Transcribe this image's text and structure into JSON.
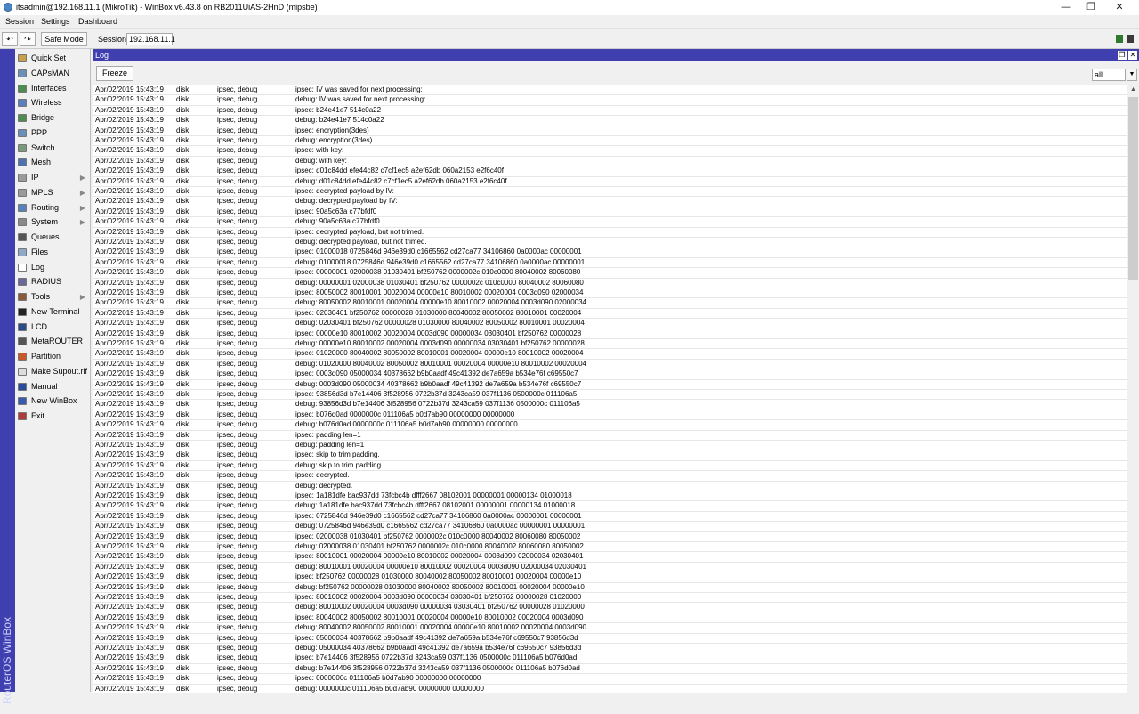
{
  "window": {
    "title": "itsadmin@192.168.11.1 (MikroTik) - WinBox v6.43.8 on RB2011UiAS-2HnD (mipsbe)",
    "minimize": "—",
    "maximize": "❐",
    "close": "✕"
  },
  "menu": {
    "session": "Session",
    "settings": "Settings",
    "dashboard": "Dashboard"
  },
  "toolbar": {
    "undo": "↶",
    "redo": "↷",
    "safe_mode": "Safe Mode",
    "session_label": "Session:",
    "session_value": "192.168.11.1",
    "status_colors": [
      "#2f7a2f",
      "#3a3a3a"
    ]
  },
  "side_label": "RouterOS WinBox",
  "sidebar": {
    "items": [
      {
        "label": "Quick Set",
        "icon": "quick-set-icon",
        "color": "#c8a048",
        "arrow": ""
      },
      {
        "label": "CAPsMAN",
        "icon": "capsman-icon",
        "color": "#6a8fb8",
        "arrow": ""
      },
      {
        "label": "Interfaces",
        "icon": "interfaces-icon",
        "color": "#4f8a4f",
        "arrow": ""
      },
      {
        "label": "Wireless",
        "icon": "wireless-icon",
        "color": "#5a7fbf",
        "arrow": ""
      },
      {
        "label": "Bridge",
        "icon": "bridge-icon",
        "color": "#4f8a4f",
        "arrow": ""
      },
      {
        "label": "PPP",
        "icon": "ppp-icon",
        "color": "#6a8fb8",
        "arrow": ""
      },
      {
        "label": "Switch",
        "icon": "switch-icon",
        "color": "#7a9a7a",
        "arrow": ""
      },
      {
        "label": "Mesh",
        "icon": "mesh-icon",
        "color": "#4c72b0",
        "arrow": ""
      },
      {
        "label": "IP",
        "icon": "ip-icon",
        "color": "#9a9a9a",
        "arrow": "▶"
      },
      {
        "label": "MPLS",
        "icon": "mpls-icon",
        "color": "#9a9a9a",
        "arrow": "▶"
      },
      {
        "label": "Routing",
        "icon": "routing-icon",
        "color": "#5a7fbf",
        "arrow": "▶"
      },
      {
        "label": "System",
        "icon": "system-icon",
        "color": "#8a8a8a",
        "arrow": "▶"
      },
      {
        "label": "Queues",
        "icon": "queues-icon",
        "color": "#555555",
        "arrow": ""
      },
      {
        "label": "Files",
        "icon": "files-icon",
        "color": "#8fa8c8",
        "arrow": ""
      },
      {
        "label": "Log",
        "icon": "log-icon",
        "color": "#ffffff",
        "arrow": ""
      },
      {
        "label": "RADIUS",
        "icon": "radius-icon",
        "color": "#6a6a9a",
        "arrow": ""
      },
      {
        "label": "Tools",
        "icon": "tools-icon",
        "color": "#8a5a3a",
        "arrow": "▶"
      },
      {
        "label": "New Terminal",
        "icon": "terminal-icon",
        "color": "#222222",
        "arrow": ""
      },
      {
        "label": "LCD",
        "icon": "lcd-icon",
        "color": "#2a4a8a",
        "arrow": ""
      },
      {
        "label": "MetaROUTER",
        "icon": "metarouter-icon",
        "color": "#555555",
        "arrow": ""
      },
      {
        "label": "Partition",
        "icon": "partition-icon",
        "color": "#c85a2a",
        "arrow": ""
      },
      {
        "label": "Make Supout.rif",
        "icon": "supout-icon",
        "color": "#dddddd",
        "arrow": ""
      },
      {
        "label": "Manual",
        "icon": "manual-icon",
        "color": "#2a4a9a",
        "arrow": ""
      },
      {
        "label": "New WinBox",
        "icon": "winbox-icon",
        "color": "#3a5ab0",
        "arrow": ""
      },
      {
        "label": "Exit",
        "icon": "exit-icon",
        "color": "#b03a3a",
        "arrow": ""
      }
    ]
  },
  "log": {
    "title": "Log",
    "freeze": "Freeze",
    "filter": "all",
    "restore": "❐",
    "close": "✕",
    "date": "Apr/02/2019 15:43:19",
    "buffer": "disk",
    "topics": "ipsec, debug",
    "rows": [
      "ipsec: IV was saved for next processing:",
      "debug: IV was saved for next processing:",
      "ipsec: b24e41e7 514c0a22",
      "debug: b24e41e7 514c0a22",
      "ipsec: encryption(3des)",
      "debug: encryption(3des)",
      "ipsec: with key:",
      "debug: with key:",
      "ipsec: d01c84dd efe44c82 c7cf1ec5 a2ef62db 060a2153 e2f6c40f",
      "debug: d01c84dd efe44c82 c7cf1ec5 a2ef62db 060a2153 e2f6c40f",
      "ipsec: decrypted payload by IV:",
      "debug: decrypted payload by IV:",
      "ipsec: 90a5c63a c77bfdf0",
      "debug: 90a5c63a c77bfdf0",
      "ipsec: decrypted payload, but not trimed.",
      "debug: decrypted payload, but not trimed.",
      "ipsec: 01000018 0725846d 946e39d0 c1665562 cd27ca77 34106860 0a0000ac 00000001",
      "debug: 01000018 0725846d 946e39d0 c1665562 cd27ca77 34106860 0a0000ac 00000001",
      "ipsec: 00000001 02000038 01030401 bf250762 0000002c 010c0000 80040002 80060080",
      "debug: 00000001 02000038 01030401 bf250762 0000002c 010c0000 80040002 80060080",
      "ipsec: 80050002 80010001 00020004 00000e10 80010002 00020004 0003d090 02000034",
      "debug: 80050002 80010001 00020004 00000e10 80010002 00020004 0003d090 02000034",
      "ipsec: 02030401 bf250762 00000028 01030000 80040002 80050002 80010001 00020004",
      "debug: 02030401 bf250762 00000028 01030000 80040002 80050002 80010001 00020004",
      "ipsec: 00000e10 80010002 00020004 0003d090 00000034 03030401 bf250762 00000028",
      "debug: 00000e10 80010002 00020004 0003d090 00000034 03030401 bf250762 00000028",
      "ipsec: 01020000 80040002 80050002 80010001 00020004 00000e10 80010002 00020004",
      "debug: 01020000 80040002 80050002 80010001 00020004 00000e10 80010002 00020004",
      "ipsec: 0003d090 05000034 40378662 b9b0aadf 49c41392 de7a659a b534e76f c69550c7",
      "debug: 0003d090 05000034 40378662 b9b0aadf 49c41392 de7a659a b534e76f c69550c7",
      "ipsec: 93856d3d b7e14406 3f528956 0722b37d 3243ca59 037f1136 0500000c 011106a5",
      "debug: 93856d3d b7e14406 3f528956 0722b37d 3243ca59 037f1136 0500000c 011106a5",
      "ipsec: b076d0ad 0000000c 011106a5 b0d7ab90 00000000 00000000",
      "debug: b076d0ad 0000000c 011106a5 b0d7ab90 00000000 00000000",
      "ipsec: padding len=1",
      "debug: padding len=1",
      "ipsec: skip to trim padding.",
      "debug: skip to trim padding.",
      "ipsec: decrypted.",
      "debug: decrypted.",
      "ipsec: 1a181dfe bac937dd 73fcbc4b dfff2667 08102001 00000001 00000134 01000018",
      "debug: 1a181dfe bac937dd 73fcbc4b dfff2667 08102001 00000001 00000134 01000018",
      "ipsec: 0725846d 946e39d0 c1665562 cd27ca77 34106860 0a0000ac 00000001 00000001",
      "debug: 0725846d 946e39d0 c1665562 cd27ca77 34106860 0a0000ac 00000001 00000001",
      "ipsec: 02000038 01030401 bf250762 0000002c 010c0000 80040002 80060080 80050002",
      "debug: 02000038 01030401 bf250762 0000002c 010c0000 80040002 80060080 80050002",
      "ipsec: 80010001 00020004 00000e10 80010002 00020004 0003d090 02000034 02030401",
      "debug: 80010001 00020004 00000e10 80010002 00020004 0003d090 02000034 02030401",
      "ipsec: bf250762 00000028 01030000 80040002 80050002 80010001 00020004 00000e10",
      "debug: bf250762 00000028 01030000 80040002 80050002 80010001 00020004 00000e10",
      "ipsec: 80010002 00020004 0003d090 00000034 03030401 bf250762 00000028 01020000",
      "debug: 80010002 00020004 0003d090 00000034 03030401 bf250762 00000028 01020000",
      "ipsec: 80040002 80050002 80010001 00020004 00000e10 80010002 00020004 0003d090",
      "debug: 80040002 80050002 80010001 00020004 00000e10 80010002 00020004 0003d090",
      "ipsec: 05000034 40378662 b9b0aadf 49c41392 de7a659a b534e76f c69550c7 93856d3d",
      "debug: 05000034 40378662 b9b0aadf 49c41392 de7a659a b534e76f c69550c7 93856d3d",
      "ipsec: b7e14406 3f528956 0722b37d 3243ca59 037f1136 0500000c 011106a5 b076d0ad",
      "debug: b7e14406 3f528956 0722b37d 3243ca59 037f1136 0500000c 011106a5 b076d0ad",
      "ipsec: 0000000c 011106a5 b0d7ab90 00000000 00000000",
      "debug: 0000000c 011106a5 b0d7ab90 00000000 00000000"
    ]
  }
}
